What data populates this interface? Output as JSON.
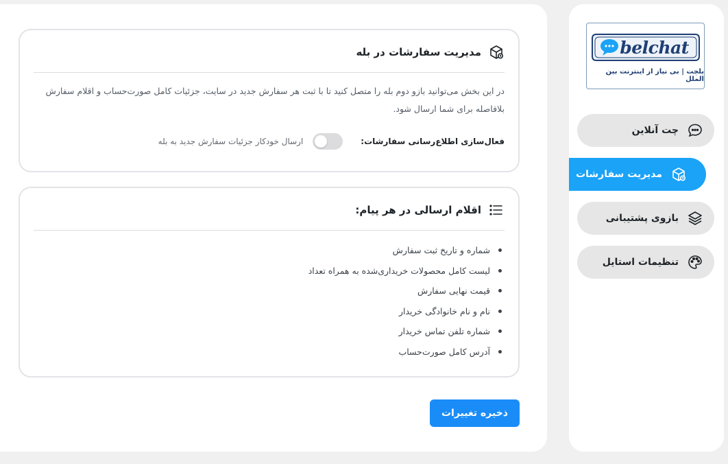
{
  "sidebar": {
    "logo": {
      "wordmark": "belchat",
      "caption": "بلچت | بی نیاز از اینترنت بین الملل"
    },
    "items": [
      {
        "label": "چت آنلاین",
        "icon": "chat-bubble-icon",
        "active": false
      },
      {
        "label": "مدیریت سفارشات",
        "icon": "package-icon",
        "active": true
      },
      {
        "label": "بازوی پشتیبانی",
        "icon": "layers-icon",
        "active": false
      },
      {
        "label": "تنظیمات استایل",
        "icon": "palette-icon",
        "active": false
      }
    ]
  },
  "orders_card": {
    "title": "مدیریت سفارشات در بله",
    "icon": "package-icon",
    "description": "در این بخش می‌توانید بازو دوم بله را متصل کنید تا با ثبت هر سفارش جدید در سایت، جزئیات کامل صورت‌حساب و اقلام سفارش بلافاصله برای شما ارسال شود.",
    "toggle_label": "فعال‌سازی اطلاع‌رسانی سفارشات:",
    "toggle_on": false,
    "toggle_note": "ارسال خودکار جزئیات سفارش جدید به بله"
  },
  "items_card": {
    "title": "اقلام ارسالی در هر پیام:",
    "icon": "list-icon",
    "items": [
      "شماره و تاریخ ثبت سفارش",
      "لیست کامل محصولات خریداری‌شده به همراه تعداد",
      "قیمت نهایی سفارش",
      "نام و نام خانوادگی خریدار",
      "شماره تلفن تماس خریدار",
      "آدرس کامل صورت‌حساب"
    ]
  },
  "save_button": {
    "label": "ذخیره تغییرات"
  },
  "colors": {
    "accent": "#1aa3f7",
    "button": "#1a8cf7",
    "logo": "#1f3f74"
  }
}
